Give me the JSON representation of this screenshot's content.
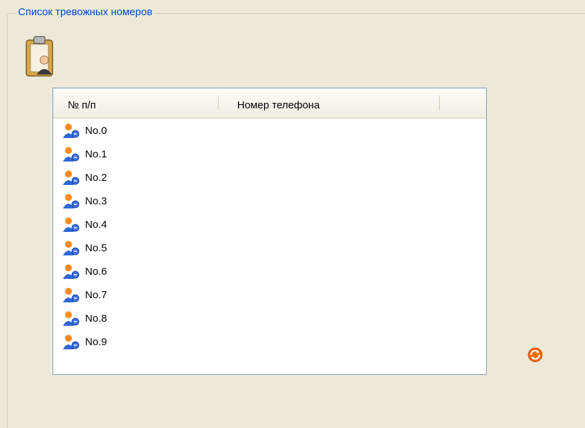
{
  "group": {
    "title": "Список тревожных номеров"
  },
  "table": {
    "columns": [
      "№ п/п",
      "Номер телефона"
    ],
    "rows": [
      "No.0",
      "No.1",
      "No.2",
      "No.3",
      "No.4",
      "No.5",
      "No.6",
      "No.7",
      "No.8",
      "No.9"
    ]
  },
  "icons": {
    "header": "clipboard-contact-icon",
    "row": "user-icon",
    "refresh": "refresh-icon"
  },
  "colors": {
    "title": "#0046d5",
    "background": "#ece9d8",
    "list_border": "#7f9db9",
    "refresh": "#ff6a00"
  }
}
